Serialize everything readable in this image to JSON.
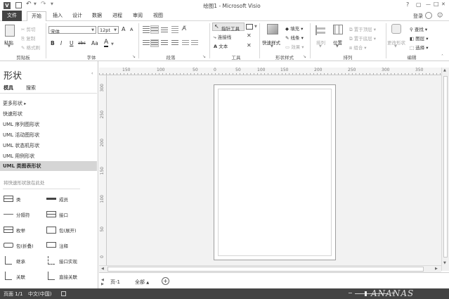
{
  "title": "绘图1 - Microsoft Visio",
  "app_icon": "V",
  "window": {
    "help": "?",
    "restore": "▢",
    "minimize": "—",
    "maximize": "□",
    "close": "✕"
  },
  "signin": "登录",
  "tabs": [
    "文件",
    "开始",
    "插入",
    "设计",
    "数据",
    "进程",
    "审阅",
    "视图"
  ],
  "clipboard": {
    "paste": "粘贴",
    "cut": "剪切",
    "copy": "复制",
    "format_painter": "格式刷",
    "label": "剪贴板"
  },
  "font": {
    "name": "宋体",
    "size": "12pt",
    "grow": "A",
    "shrink": "A",
    "bold": "B",
    "italic": "I",
    "underline": "U",
    "strike": "abc",
    "aa": "Aa",
    "color": "A",
    "label": "字体"
  },
  "paragraph": {
    "label": "段落"
  },
  "tools": {
    "pointer": "指针工具",
    "connector": "连接线",
    "text": "文本",
    "label": "工具"
  },
  "shape_style": {
    "quick": "快速样式",
    "fill": "填充",
    "line": "线条",
    "effects": "效果",
    "label": "形状样式"
  },
  "arrange": {
    "align": "排列",
    "position": "位置",
    "bring_front": "置于顶层",
    "send_back": "置于底层",
    "group": "组合",
    "label": "排列"
  },
  "editing": {
    "change_shape": "更改形状",
    "find": "查找",
    "layers": "图层",
    "select": "选择",
    "label": "编辑"
  },
  "pane": {
    "title": "形状",
    "tab_stencils": "模具",
    "tab_search": "搜索",
    "more_shapes": "更多形状",
    "stencils": [
      "快速形状",
      "UML 序列图形状",
      "UML 活动图形状",
      "UML 状态机形状",
      "UML 用例形状",
      "UML 类图表形状"
    ],
    "drop_hint": "将快速形状放在此处",
    "shapes": [
      {
        "label": "类"
      },
      {
        "label": "成员"
      },
      {
        "label": "分隔符"
      },
      {
        "label": "接口"
      },
      {
        "label": "枚举"
      },
      {
        "label": "包(展开)"
      },
      {
        "label": "包(折叠)"
      },
      {
        "label": "注释"
      },
      {
        "label": "继承"
      },
      {
        "label": "接口实现"
      },
      {
        "label": "关联"
      },
      {
        "label": "直接关联"
      }
    ]
  },
  "ruler_h": [
    "150",
    "100",
    "50",
    "0",
    "50",
    "100",
    "150",
    "200",
    "250",
    "300",
    "350"
  ],
  "ruler_v": [
    "300",
    "250",
    "200",
    "150",
    "100",
    "50",
    "0"
  ],
  "page_tab": "页-1",
  "page_all": "全部",
  "status": {
    "page": "页面 1/1",
    "language": "中文(中国)",
    "watermark": "ANANAS"
  }
}
